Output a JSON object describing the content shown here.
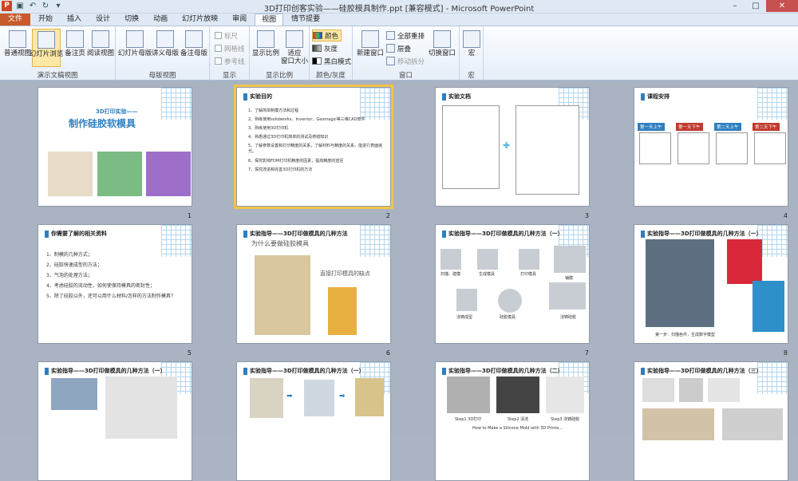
{
  "window": {
    "title": "3D打印创客实验——硅胶模具制作.ppt [兼容模式] - Microsoft PowerPoint",
    "app_icon": "P",
    "buttons": {
      "minimize": "–",
      "maximize": "□",
      "close": "✕"
    }
  },
  "tabs": [
    "文件",
    "开始",
    "插入",
    "设计",
    "切换",
    "动画",
    "幻灯片放映",
    "审阅",
    "视图",
    "情节提要"
  ],
  "active_tab": "视图",
  "ribbon": {
    "groups": [
      {
        "label": "演示文稿视图",
        "buttons": [
          "普通视图",
          "幻灯片浏览",
          "备注页",
          "阅读视图"
        ],
        "selected": "幻灯片浏览"
      },
      {
        "label": "母版视图",
        "buttons": [
          "幻灯片母版",
          "讲义母版",
          "备注母版"
        ]
      },
      {
        "label": "显示",
        "checks": [
          "标尺",
          "网格线",
          "参考线"
        ]
      },
      {
        "label": "显示比例",
        "buttons": [
          "显示比例",
          "适应\n窗口大小"
        ]
      },
      {
        "label": "颜色/灰度",
        "options": [
          "颜色",
          "灰度",
          "黑白模式"
        ]
      },
      {
        "label": "窗口",
        "buttons": [
          "新建窗口",
          "全部重排",
          "层叠",
          "移动拆分",
          "切换窗口"
        ]
      },
      {
        "label": "宏",
        "buttons": [
          "宏"
        ]
      }
    ]
  },
  "colors": {
    "accent": "#2e7fc0",
    "file_tab": "#c85b2b",
    "selection": "#f3c447",
    "red_header": "#c0392b"
  },
  "slides": [
    {
      "num": "1",
      "title": "3D打印实验——",
      "subtitle": "制作硅胶软模具"
    },
    {
      "num": "2",
      "header": "实验目的",
      "items": [
        "1、了解简单制模方法和过程",
        "2、熟练使用solidworks、Inventor、Geomagic等三维CAD软件",
        "3、熟练使用3D打印机",
        "4、熟悉通过3D打印机简单的测试及修缮知识",
        "5、了解参数设置和打印精度的关系，了解材料与精度的关系，能进行表面抛光。",
        "6、探究影响FDM打印机精度的因素，提高精度的途径",
        "7、探究改进和完善3D打印机的方法"
      ]
    },
    {
      "num": "3",
      "header": "实验文档"
    },
    {
      "num": "4",
      "header": "课程安排",
      "days": [
        "第一天上午",
        "第一天下午",
        "第二天上午",
        "第二天下午"
      ]
    },
    {
      "num": "5",
      "header": "你需要了解的相关资料",
      "items": [
        "1、制模的几种方式；",
        "2、硅胶快速成型的方法；",
        "3、气泡的处理方法；",
        "4、考虑硅胶的流动性，如何使保持模具的密封性；",
        "5、除了硅胶以外，还可以用什么材料/怎样的方法制作模具？"
      ]
    },
    {
      "num": "6",
      "header": "实验指导——3D打印做模具的几种方法",
      "q": "为什么要做硅胶模具",
      "a": "直接打印模具的缺点"
    },
    {
      "num": "7",
      "header": "实验指导——3D打印做模具的几种方法（一）",
      "steps": [
        "扫描、建模",
        "生成模具",
        "打印模具",
        "铺膜",
        "浇铸硅胶",
        "硅胶模具",
        "浇铸成型"
      ]
    },
    {
      "num": "8",
      "header": "实验指导——3D打印做模具的几种方法（一）",
      "caption": "第一步：扫描色件，生成数字模型"
    },
    {
      "num": "",
      "header": "实验指导——3D打印做模具的几种方法（一）"
    },
    {
      "num": "",
      "header": "实验指导——3D打印做模具的几种方法（一）"
    },
    {
      "num": "",
      "header": "实验指导——3D打印做模具的几种方法（二）",
      "captions": [
        "Step1 3D打印",
        "Step2 清洗",
        "Step3 浇铸硅胶"
      ],
      "footer": "How to Make a Silicone Mold with 3D Printe..."
    },
    {
      "num": "",
      "header": "实验指导——3D打印做模具的几种方法（三）"
    }
  ]
}
